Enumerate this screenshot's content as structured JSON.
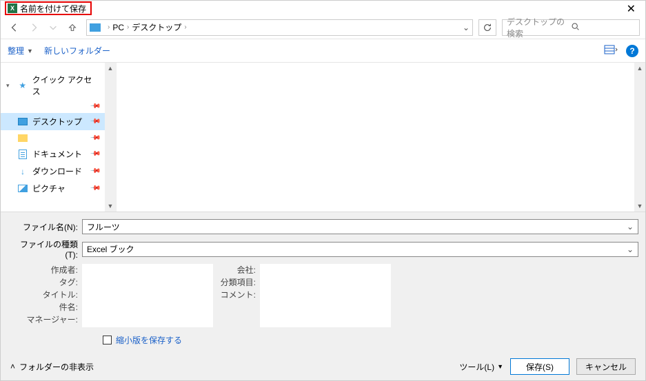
{
  "title": "名前を付けて保存",
  "breadcrumb": {
    "root": "PC",
    "current": "デスクトップ"
  },
  "search_placeholder": "デスクトップの検索",
  "toolbar": {
    "organize": "整理",
    "new_folder": "新しいフォルダー"
  },
  "sidebar": {
    "quick_access": "クイック アクセス",
    "items": [
      {
        "label": "デスクトップ",
        "type": "screen",
        "selected": true
      },
      {
        "label": "",
        "type": "folder",
        "selected": false
      },
      {
        "label": "ドキュメント",
        "type": "doc",
        "selected": false
      },
      {
        "label": "ダウンロード",
        "type": "download",
        "selected": false
      },
      {
        "label": "ピクチャ",
        "type": "picture",
        "selected": false
      }
    ]
  },
  "form": {
    "filename_label": "ファイル名(N):",
    "filename_value": "フルーツ",
    "filetype_label": "ファイルの種類(T):",
    "filetype_value": "Excel ブック"
  },
  "meta": {
    "left": [
      "作成者:",
      "タグ:",
      "タイトル:",
      "件名:",
      "マネージャー:"
    ],
    "right": [
      "会社:",
      "分類項目:",
      "コメント:"
    ]
  },
  "save_thumbnail": "縮小版を保存する",
  "footer": {
    "hide_folders": "フォルダーの非表示",
    "tools": "ツール(L)",
    "save": "保存(S)",
    "cancel": "キャンセル"
  }
}
